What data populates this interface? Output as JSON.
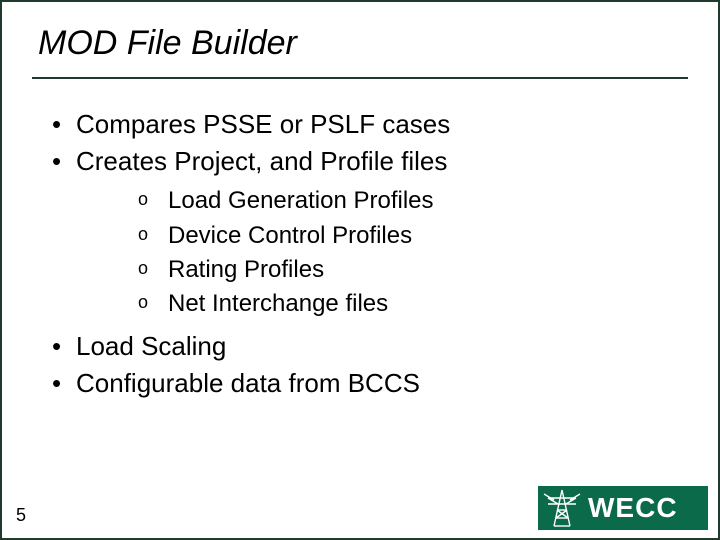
{
  "title": "MOD File Builder",
  "bullets": {
    "b1": "Compares PSSE or PSLF cases",
    "b2": "Creates Project, and Profile files",
    "sub1": "Load Generation Profiles",
    "sub2": "Device Control Profiles",
    "sub3": "Rating Profiles",
    "sub4": "Net Interchange files",
    "b3": "Load Scaling",
    "b4": "Configurable data from BCCS"
  },
  "page_number": "5",
  "logo_text": "WECC"
}
